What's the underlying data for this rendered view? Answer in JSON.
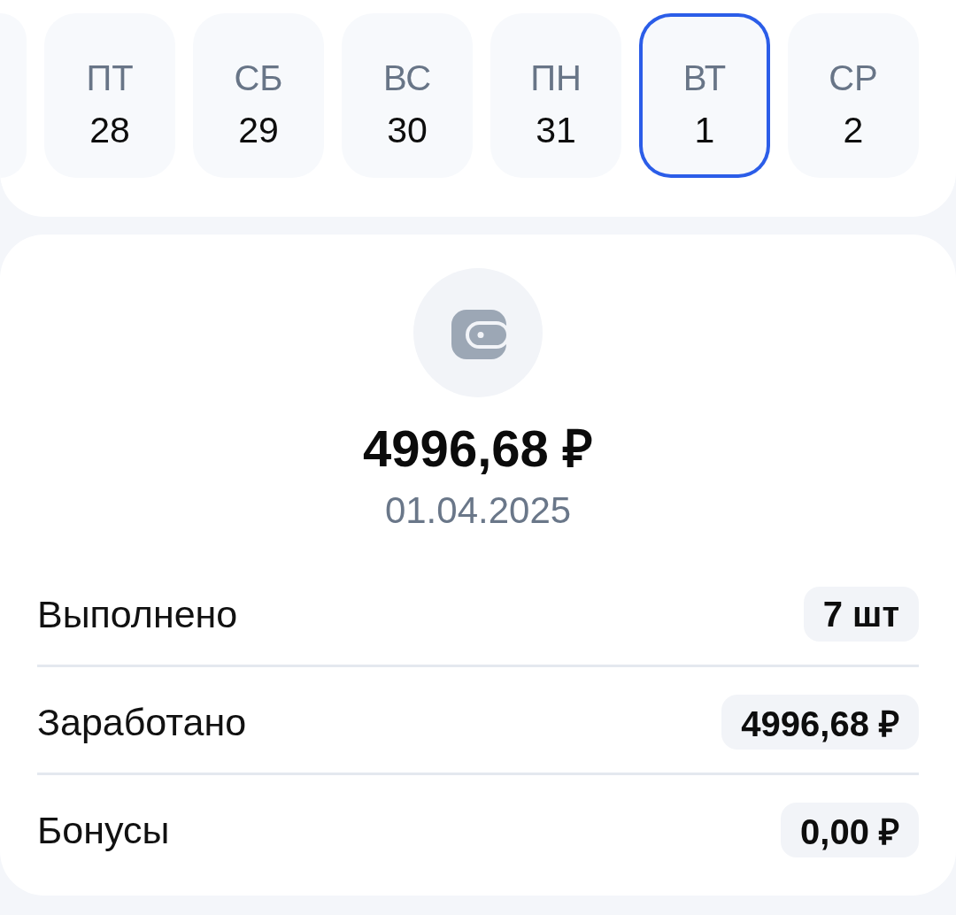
{
  "days": [
    {
      "kind": "edge",
      "selected": false
    },
    {
      "kind": "day",
      "weekday": "ПТ",
      "day": "28",
      "selected": false
    },
    {
      "kind": "day",
      "weekday": "СБ",
      "day": "29",
      "selected": false
    },
    {
      "kind": "day",
      "weekday": "ВС",
      "day": "30",
      "selected": false
    },
    {
      "kind": "day",
      "weekday": "ПН",
      "day": "31",
      "selected": false
    },
    {
      "kind": "day",
      "weekday": "ВТ",
      "day": "1",
      "selected": true
    },
    {
      "kind": "day",
      "weekday": "СР",
      "day": "2",
      "selected": false
    }
  ],
  "summary": {
    "amount": "4996,68 ₽",
    "date": "01.04.2025"
  },
  "stats": [
    {
      "label": "Выполнено",
      "value": "7 шт"
    },
    {
      "label": "Заработано",
      "value": "4996,68 ₽"
    },
    {
      "label": "Бонусы",
      "value": "0,00 ₽"
    }
  ]
}
